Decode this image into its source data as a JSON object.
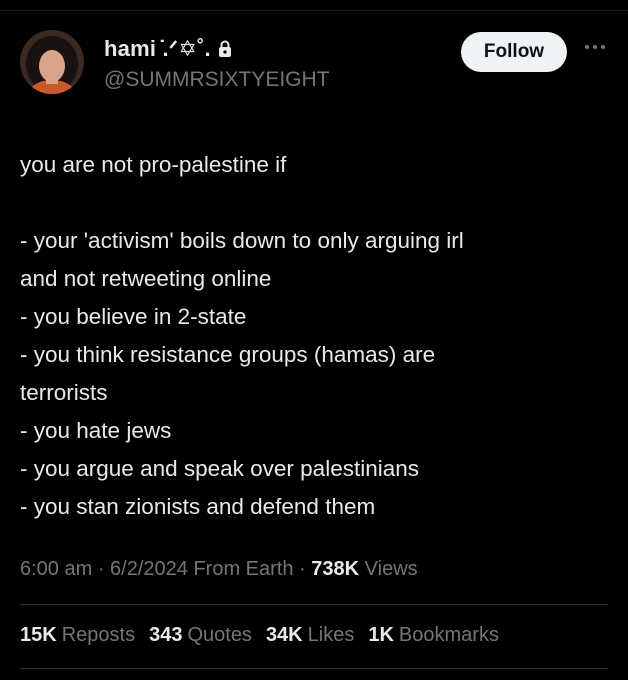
{
  "author": {
    "display_name": "hami ̇.ᐟ✡︎˚.",
    "handle": "@SUMMRSIXTYEIGHT",
    "avatar_icon": "profile-photo",
    "lock_icon": "lock-icon"
  },
  "follow_label": "Follow",
  "more_icon": "more-horizontal-icon",
  "tweet": {
    "lines": [
      "you are not pro-palestine if",
      "",
      "- your 'activism' boils down to only arguing irl",
      "and not retweeting online",
      "- you believe in 2-state",
      "- you think resistance groups (hamas) are",
      "terrorists",
      "- you hate jews",
      "- you argue and speak over palestinians",
      "- you stan zionists and defend them"
    ]
  },
  "meta": {
    "time": "6:00 am",
    "date": "6/2/2024",
    "source": "From Earth",
    "views_count": "738K",
    "views_label": "Views"
  },
  "stats": {
    "reposts_count": "15K",
    "reposts_label": "Reposts",
    "quotes_count": "343",
    "quotes_label": "Quotes",
    "likes_count": "34K",
    "likes_label": "Likes",
    "bookmarks_count": "1K",
    "bookmarks_label": "Bookmarks"
  },
  "colors": {
    "background": "#000000",
    "text": "#e7e9ea",
    "muted": "#71767b",
    "divider": "#2f3336",
    "button_bg": "#eff3f4"
  }
}
